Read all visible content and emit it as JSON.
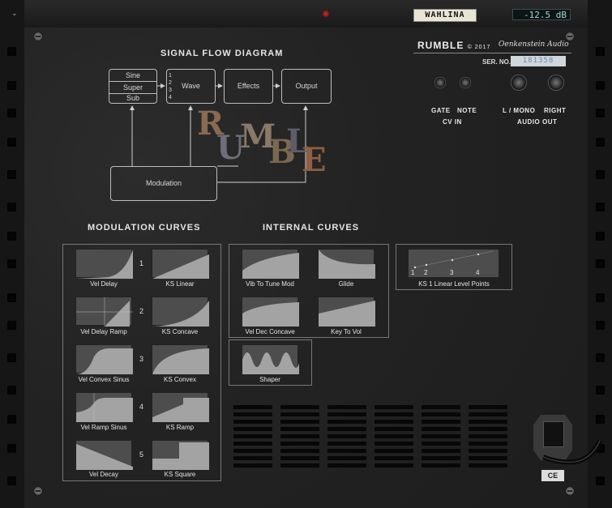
{
  "top": {
    "name_tape": "WAHLINA",
    "level_display": "-12.5 dB"
  },
  "flow": {
    "title": "SIGNAL FLOW DIAGRAM",
    "osc": [
      "Sine",
      "Super",
      "Sub"
    ],
    "wave_nums": [
      "1",
      "2",
      "3",
      "4"
    ],
    "wave": "Wave",
    "effects": "Effects",
    "output": "Output",
    "modulation": "Modulation"
  },
  "logo_letters": [
    "R",
    "U",
    "M",
    "B",
    "L",
    "E"
  ],
  "brand": {
    "name": "RUMBLE",
    "year": "© 2017",
    "maker": "Oenkenstein Audio",
    "serial_label": "SER. NO.",
    "serial": "181358"
  },
  "jacks": {
    "gate": "GATE",
    "note": "NOTE",
    "cv_in": "CV IN",
    "lmono": "L / MONO",
    "right": "RIGHT",
    "audio_out": "AUDIO OUT"
  },
  "mod_curves": {
    "title": "MODULATION CURVES",
    "rows": [
      {
        "num": "1",
        "left": "Vel Delay",
        "right": "KS Linear"
      },
      {
        "num": "2",
        "left": "Vel Delay Ramp",
        "right": "KS Concave"
      },
      {
        "num": "3",
        "left": "Vel Convex Sinus",
        "right": "KS Convex"
      },
      {
        "num": "4",
        "left": "Vel Ramp Sinus",
        "right": "KS Ramp"
      },
      {
        "num": "5",
        "left": "Vel Decay",
        "right": "KS Square"
      }
    ]
  },
  "internal_curves": {
    "title": "INTERNAL CURVES",
    "items": [
      "Vib To Tune Mod",
      "Glide",
      "Vel Dec Concave",
      "Key To Vol",
      "Shaper"
    ]
  },
  "ks_points": {
    "label": "KS 1 Linear Level Points",
    "ticks": [
      "1",
      "2",
      "3",
      "4"
    ]
  },
  "ce_mark": "CE"
}
